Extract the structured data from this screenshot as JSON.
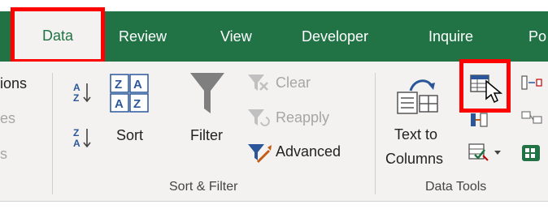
{
  "tabs": [
    {
      "label": "Data"
    },
    {
      "label": "Review"
    },
    {
      "label": "View"
    },
    {
      "label": "Developer"
    },
    {
      "label": "Inquire"
    },
    {
      "label": "Po"
    }
  ],
  "get_transform": {
    "items": [
      "ions",
      "es",
      "s"
    ]
  },
  "sort_filter": {
    "sort_label": "Sort",
    "filter_label": "Filter",
    "clear_label": "Clear",
    "reapply_label": "Reapply",
    "advanced_label": "Advanced",
    "group_label": "Sort & Filter"
  },
  "data_tools": {
    "text_to_columns_line1": "Text to",
    "text_to_columns_line2": "Columns",
    "group_label": "Data Tools"
  },
  "colors": {
    "ribbon_green": "#217346",
    "highlight": "#ff0000",
    "ribbon_bg": "#f3f2f1"
  }
}
